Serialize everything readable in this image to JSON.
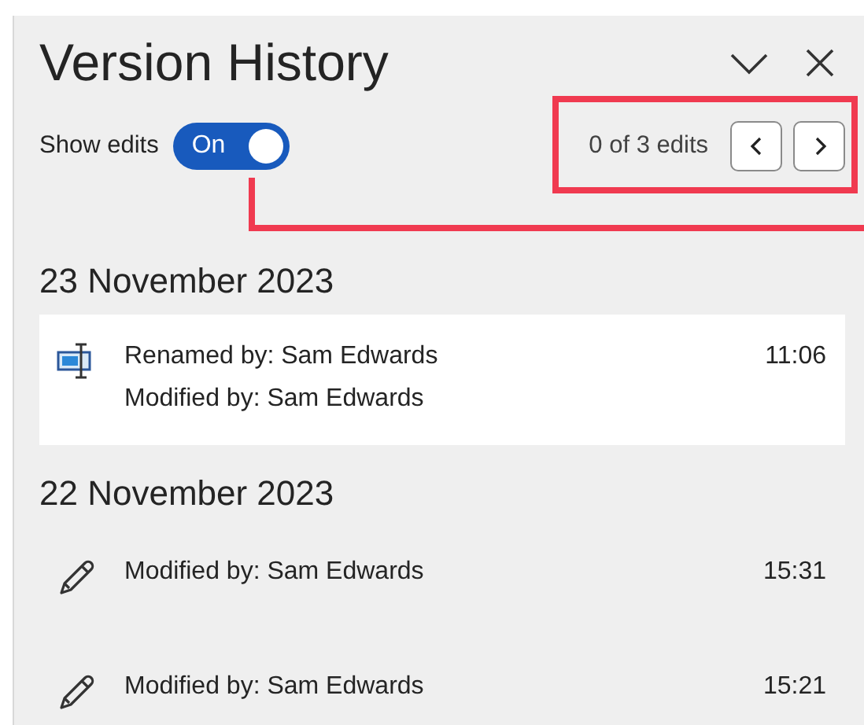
{
  "panel": {
    "title": "Version History"
  },
  "show_edits": {
    "label": "Show edits",
    "on": true,
    "state_text": "On"
  },
  "edit_nav": {
    "count": "0 of 3 edits"
  },
  "annotation": {
    "shown": true
  },
  "sections": [
    {
      "date": "23 November 2023",
      "entries": [
        {
          "kind": "renamed",
          "lines": [
            "Renamed by: Sam Edwards",
            "Modified by: Sam Edwards"
          ],
          "time": "11:06",
          "selected": true
        }
      ]
    },
    {
      "date": "22 November 2023",
      "entries": [
        {
          "kind": "modified",
          "lines": [
            "Modified by: Sam Edwards"
          ],
          "time": "15:31",
          "selected": false
        },
        {
          "kind": "modified",
          "lines": [
            "Modified by: Sam Edwards"
          ],
          "time": "15:21",
          "selected": false
        }
      ]
    }
  ]
}
